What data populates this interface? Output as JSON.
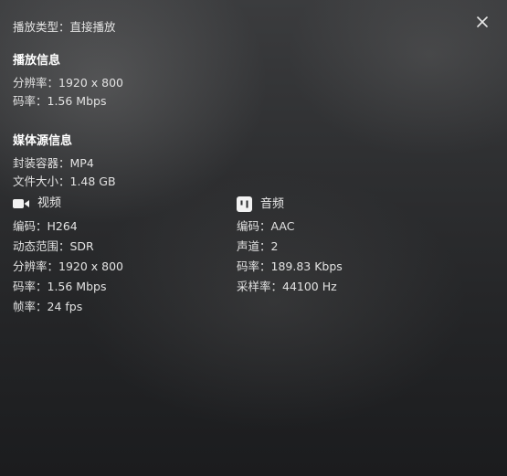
{
  "play_type": "播放类型：直接播放",
  "playback_info": {
    "title": "播放信息",
    "resolution": "分辨率：1920 x 800",
    "bitrate": "码率：1.56 Mbps"
  },
  "media_info": {
    "title": "媒体源信息",
    "container": "封装容器：MP4",
    "file_size": "文件大小：1.48 GB"
  },
  "video": {
    "icon": "video-camera-icon",
    "label": "视频",
    "codec": "编码：H264",
    "dynamic_range": "动态范围：SDR",
    "resolution": "分辨率：1920 x 800",
    "bitrate": "码率：1.56 Mbps",
    "frame_rate": "帧率：24 fps"
  },
  "audio": {
    "icon": "audio-track-icon",
    "label": "音频",
    "codec": "编码：AAC",
    "channels": "声道：2",
    "bitrate": "码率：189.83 Kbps",
    "sample_rate": "采样率：44100 Hz"
  },
  "close_icon": "close-icon"
}
